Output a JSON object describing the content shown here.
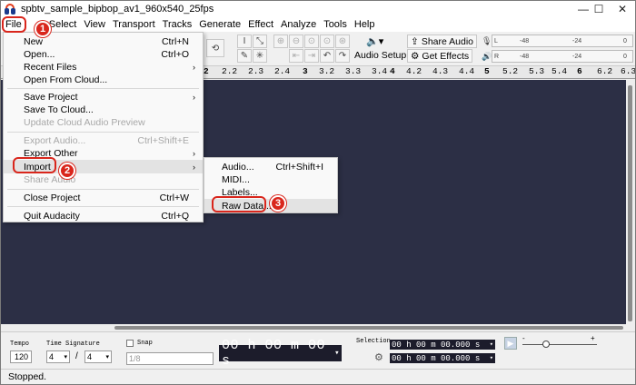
{
  "window": {
    "title": "spbtv_sample_bipbop_av1_960x540_25fps",
    "minimize": "—",
    "maximize": "☐",
    "close": "✕"
  },
  "menubar": [
    "File",
    "Edit",
    "Select",
    "View",
    "Transport",
    "Tracks",
    "Generate",
    "Effect",
    "Analyze",
    "Tools",
    "Help"
  ],
  "menubar_visible_labels": {
    "edit_select": "Select"
  },
  "toolbar": {
    "audio_setup": "Audio Setup",
    "share_audio": "Share Audio",
    "get_effects": "Get Effects",
    "meter_ticks": [
      "-48",
      "-24",
      "0"
    ],
    "meter_channels": [
      "L",
      "R"
    ]
  },
  "ruler": {
    "ticks": [
      "2",
      "2.2",
      "2.3",
      "2.4",
      "3",
      "3.2",
      "3.3",
      "3.4",
      "4",
      "4.2",
      "4.3",
      "4.4",
      "5",
      "5.2",
      "5.3",
      "5.4",
      "6",
      "6.2",
      "6.3"
    ]
  },
  "file_menu": {
    "items": [
      {
        "label": "New",
        "shortcut": "Ctrl+N"
      },
      {
        "label": "Open...",
        "shortcut": "Ctrl+O"
      },
      {
        "label": "Recent Files",
        "submenu": "›"
      },
      {
        "label": "Open From Cloud..."
      },
      {
        "label": "Save Project",
        "submenu": "›"
      },
      {
        "label": "Save To Cloud..."
      },
      {
        "label": "Update Cloud Audio Preview",
        "disabled": true
      },
      {
        "label": "Export Audio...",
        "shortcut": "Ctrl+Shift+E",
        "disabled": true
      },
      {
        "label": "Export Other",
        "submenu": "›"
      },
      {
        "label": "Import",
        "submenu": "›"
      },
      {
        "label": "Share Audio",
        "disabled": true
      },
      {
        "label": "Close Project",
        "shortcut": "Ctrl+W"
      },
      {
        "label": "Quit Audacity",
        "shortcut": "Ctrl+Q"
      }
    ]
  },
  "import_menu": {
    "items": [
      {
        "label": "Audio...",
        "shortcut": "Ctrl+Shift+I"
      },
      {
        "label": "MIDI..."
      },
      {
        "label": "Labels..."
      },
      {
        "label": "Raw Data..."
      }
    ]
  },
  "callouts": [
    "1",
    "2",
    "3"
  ],
  "bottom": {
    "tempo_label": "Tempo",
    "tempo_value": "120",
    "time_sig_label": "Time Signature",
    "time_sig_num": "4",
    "time_sig_sep": "/",
    "time_sig_den": "4",
    "snap_label": "Snap",
    "snap_value": "1/8",
    "time_display": "00 h 00 m 00 s",
    "selection_label": "Selection",
    "selection_start": "00 h 00 m 00.000 s",
    "selection_end": "00 h 00 m 00.000 s",
    "speed_minus": "-",
    "speed_plus": "+"
  },
  "status": "Stopped."
}
